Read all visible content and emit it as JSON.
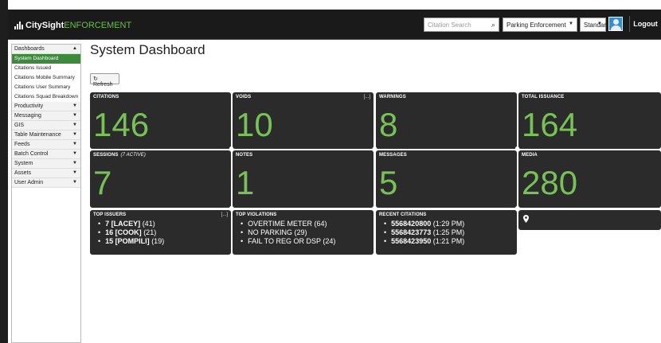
{
  "header": {
    "brand_main": "CitySight",
    "brand_accent": "ENFORCEMENT",
    "search_placeholder": "Citation Search",
    "module_select": "Parking Enforcement",
    "mode_select": "Standard",
    "logout_label": "Logout"
  },
  "sidebar": {
    "sections": [
      {
        "label": "Dashboards",
        "chevron": "▲"
      },
      {
        "label": "Productivity",
        "chevron": "▼"
      },
      {
        "label": "Messaging",
        "chevron": "▼"
      },
      {
        "label": "GIS",
        "chevron": "▼"
      },
      {
        "label": "Table Maintenance",
        "chevron": "▼"
      },
      {
        "label": "Feeds",
        "chevron": "▼"
      },
      {
        "label": "Batch Control",
        "chevron": "▼"
      },
      {
        "label": "System",
        "chevron": "▼"
      },
      {
        "label": "Assets",
        "chevron": "▼"
      },
      {
        "label": "User Admin",
        "chevron": "▼"
      }
    ],
    "dashboard_items": [
      "System Dashboard",
      "Citations Issued",
      "Citations Mobile Summary",
      "Citations User Summary",
      "Citations Squad Breakdown"
    ]
  },
  "main": {
    "title": "System Dashboard",
    "refresh_label": "Refresh"
  },
  "tiles": {
    "citations": {
      "label": "CITATIONS",
      "value": "146"
    },
    "voids": {
      "label": "VOIDS",
      "value": "10",
      "more": "[...]"
    },
    "warnings": {
      "label": "WARNINGS",
      "value": "8"
    },
    "total_issuance": {
      "label": "TOTAL ISSUANCE",
      "value": "164"
    },
    "sessions": {
      "label": "SESSIONS",
      "sub": "(7 ACTIVE)",
      "value": "7"
    },
    "notes": {
      "label": "NOTES",
      "value": "1"
    },
    "messages": {
      "label": "MESSAGES",
      "value": "5"
    },
    "media": {
      "label": "MEDIA",
      "value": "280"
    },
    "top_issuers": {
      "label": "TOP ISSUERS",
      "more": "[...]",
      "items": [
        {
          "name": "7 [LACEY]",
          "count": "(41)"
        },
        {
          "name": "16 [COOK]",
          "count": "(21)"
        },
        {
          "name": "15 [POMPILI]",
          "count": "(19)"
        }
      ]
    },
    "top_violations": {
      "label": "TOP VIOLATIONS",
      "items": [
        "OVERTIME METER (64)",
        "NO PARKING (29)",
        "FAIL TO REG OR DSP (24)"
      ]
    },
    "recent_citations": {
      "label": "RECENT CITATIONS",
      "items": [
        {
          "number": "5568420800",
          "time": "(1:29 PM)"
        },
        {
          "number": "5568423773",
          "time": "(1:25 PM)"
        },
        {
          "number": "5568423950",
          "time": "(1:21 PM)"
        }
      ]
    }
  },
  "colors": {
    "accent_green": "#77c156",
    "active_nav": "#3d8a3d",
    "tile_bg": "#2b2b2b",
    "header_bg": "#1a1a1a"
  }
}
